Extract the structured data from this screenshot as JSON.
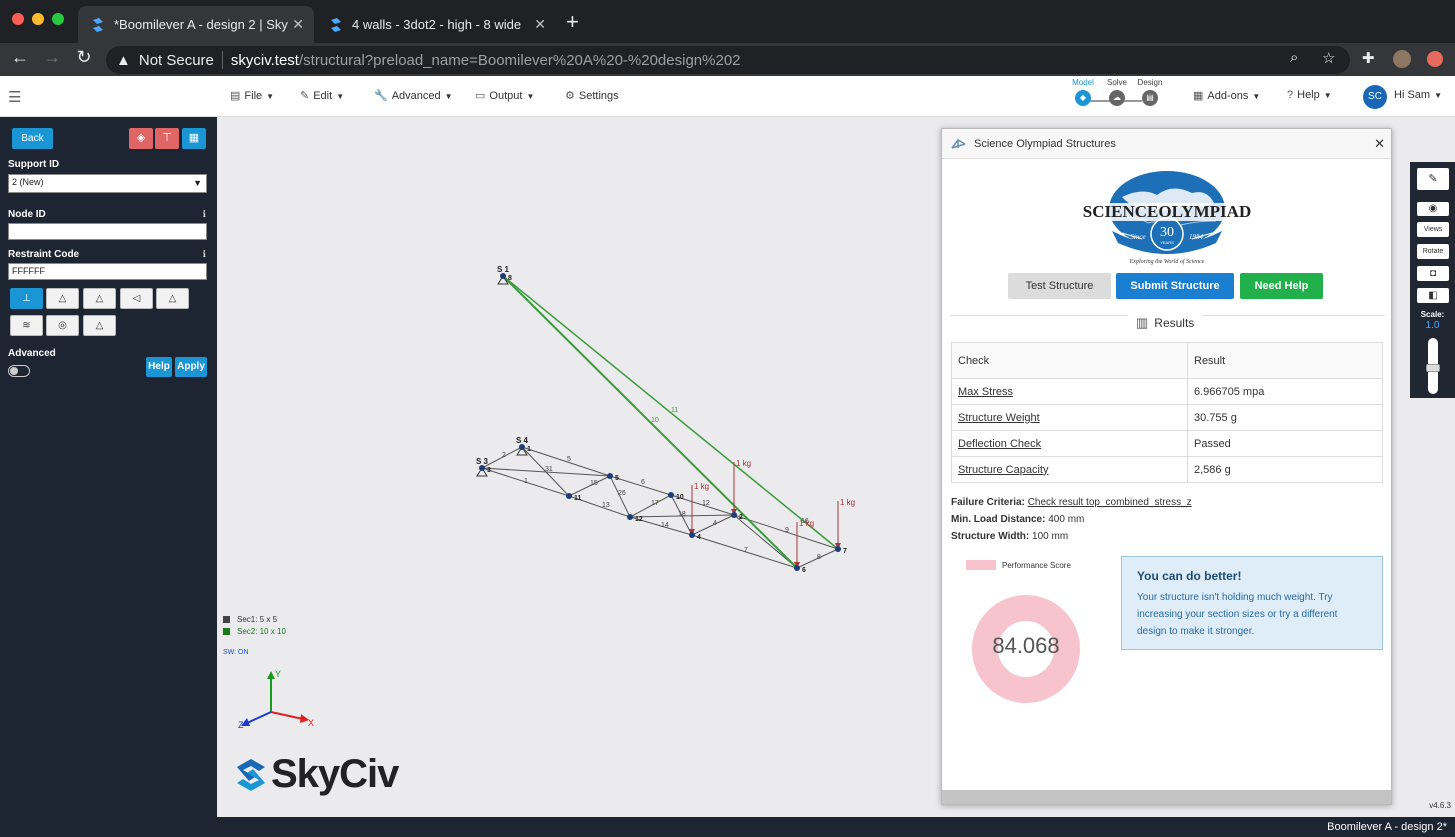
{
  "browser": {
    "tabs": [
      {
        "title": "*Boomilever A - design 2 | Sky",
        "active": true
      },
      {
        "title": "4 walls - 3dot2 - high - 8 wide",
        "active": false
      }
    ],
    "url": {
      "security": "Not Secure",
      "host": "skyciv.test",
      "path": "/structural?preload_name=Boomilever%20A%20-%20design%202"
    }
  },
  "menu": {
    "file": "File",
    "edit": "Edit",
    "advanced": "Advanced",
    "output": "Output",
    "settings": "Settings",
    "addons": "Add-ons",
    "help": "Help",
    "user_initials": "SC",
    "user_greeting": "Hi Sam"
  },
  "workflow": {
    "model": "Model",
    "solve": "Solve",
    "design": "Design"
  },
  "sidebar": {
    "back": "Back",
    "support_id_label": "Support ID",
    "support_id_value": "2 (New)",
    "node_id_label": "Node ID",
    "node_id_value": "",
    "restraint_label": "Restraint Code",
    "restraint_value": "FFFFFF",
    "advanced_label": "Advanced",
    "help_btn": "Help",
    "apply_btn": "Apply"
  },
  "canvas": {
    "legend": [
      {
        "label": "Sec1: 5 x 5",
        "color": "#444444"
      },
      {
        "label": "Sec2: 10 x 10",
        "color": "#1a7a1a"
      }
    ],
    "self_weight": "SW: ON",
    "axes": {
      "x": "X",
      "y": "Y",
      "z": "Z"
    },
    "support_labels": [
      "S 1",
      "S 4",
      "S 3"
    ],
    "node_labels": [
      "8",
      "1",
      "3",
      "5",
      "11",
      "12",
      "10",
      "2",
      "4",
      "6",
      "7"
    ],
    "member_labels": [
      "2",
      "5",
      "31",
      "15",
      "26",
      "6",
      "1",
      "13",
      "17",
      "18",
      "14",
      "12",
      "4",
      "7",
      "9",
      "8",
      "16",
      "10",
      "11"
    ],
    "load_label": "1 kg",
    "brand": "SkyCiv",
    "version": "v4.6.3"
  },
  "panel": {
    "title": "Science Olympiad Structures",
    "logo": {
      "name": "SCIENCEOLYMPIAD",
      "years": "30",
      "since": "Since",
      "year": "1984",
      "tagline": "Exploring the World of Science"
    },
    "test_btn": "Test Structure",
    "submit_btn": "Submit Structure",
    "help_btn": "Need Help",
    "results_title": "Results",
    "table_head": {
      "check": "Check",
      "result": "Result"
    },
    "rows": [
      {
        "check": "Max Stress",
        "result": "6.966705 mpa"
      },
      {
        "check": "Structure Weight",
        "result": "30.755 g"
      },
      {
        "check": "Deflection Check",
        "result": "Passed"
      },
      {
        "check": "Structure Capacity",
        "result": "2,586 g"
      }
    ],
    "failure_label": "Failure Criteria:",
    "failure_value": "Check result top_combined_stress_z",
    "min_load_label": "Min. Load Distance:",
    "min_load_value": "400 mm",
    "width_label": "Structure Width:",
    "width_value": "100 mm",
    "perf_legend": "Performance Score",
    "perf_value": "84.068",
    "alert_title": "You can do better!",
    "alert_msg": "Your structure isn't holding much weight. Try increasing your section sizes or try a different design to make it stronger."
  },
  "toolbar": {
    "views": "Views",
    "rotate": "Rotate",
    "scale_label": "Scale:",
    "scale_value": "1.0"
  },
  "status": "Boomilever A - design 2*",
  "colors": {
    "accent": "#1a96d4",
    "sidebar": "#1e2532",
    "success": "#22b04b",
    "danger": "#e06666",
    "perf": "#f7c4cd"
  }
}
